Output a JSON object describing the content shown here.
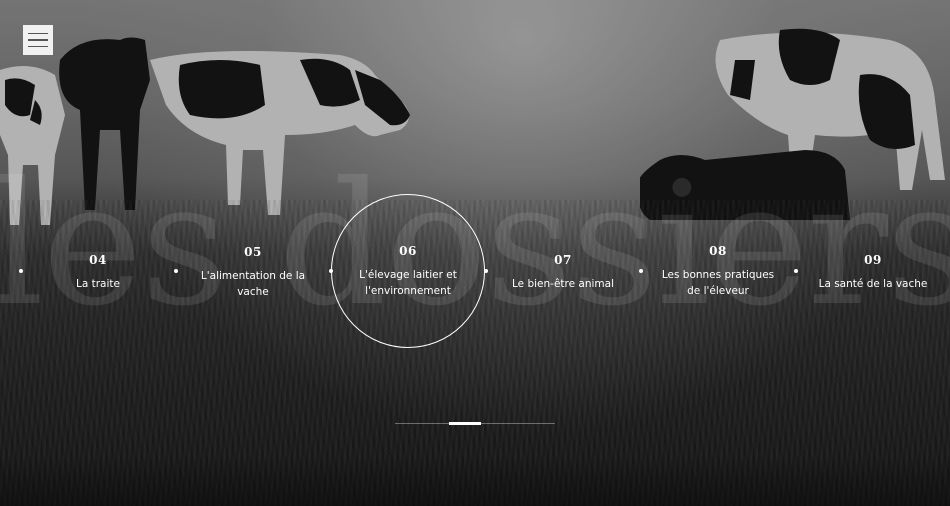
{
  "menu": {
    "icon": "hamburger-menu-icon"
  },
  "watermark_text": "les dossiers",
  "items": [
    {
      "num": "04",
      "label": "La traite"
    },
    {
      "num": "05",
      "label": "L'alimentation de la vache"
    },
    {
      "num": "06",
      "label": "L'élevage laitier et l'environnement",
      "active": true
    },
    {
      "num": "07",
      "label": "Le bien-être animal"
    },
    {
      "num": "08",
      "label": "Les bonnes pratiques de l'éleveur"
    },
    {
      "num": "09",
      "label": "La santé de la vache"
    }
  ],
  "progress": {
    "fraction": 0.2,
    "position_fraction": 0.34
  },
  "colors": {
    "text": "#ffffff",
    "accent": "#ffffff"
  }
}
